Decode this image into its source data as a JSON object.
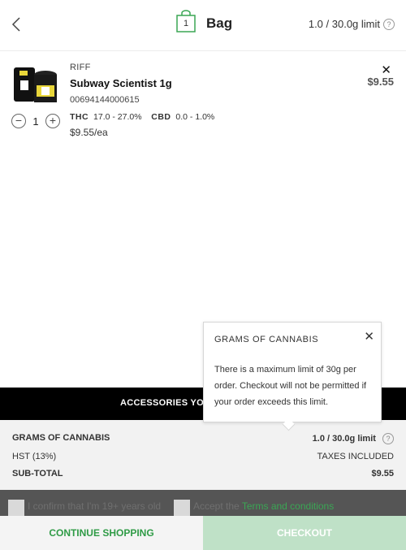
{
  "header": {
    "title": "Bag",
    "bag_count": "1",
    "limit_text": "1.0 / 30.0g limit"
  },
  "product": {
    "brand": "RIFF",
    "name": "Subway Scientist 1g",
    "sku": "00694144000615",
    "thc_label": "THC",
    "thc_value": "17.0 - 27.0%",
    "cbd_label": "CBD",
    "cbd_value": "0.0 - 1.0%",
    "unit_price": "$9.55/ea",
    "quantity": "1",
    "price": "$9.55",
    "remove_glyph": "✕"
  },
  "accessories": {
    "label": "ACCESSORIES YOU"
  },
  "summary": {
    "grams_label": "GRAMS OF CANNABIS",
    "grams_value": "1.0 / 30.0g limit",
    "hst_label": "HST (13%)",
    "hst_value": "TAXES INCLUDED",
    "subtotal_label": "SUB-TOTAL",
    "subtotal_value": "$9.55"
  },
  "confirm": {
    "age_text": "I confirm that I'm 19+ years old",
    "accept_text": "Accept the",
    "terms_link": "Terms and conditions"
  },
  "footer": {
    "continue_label": "CONTINUE SHOPPING",
    "checkout_label": "CHECKOUT"
  },
  "tooltip": {
    "title": "GRAMS OF CANNABIS",
    "body": "There is a maximum limit of 30g per order. Checkout will not be permitted if your order exceeds this limit.",
    "close_glyph": "✕"
  },
  "colors": {
    "accent_green": "#2f9b46",
    "checkout_disabled": "#bfe1c7"
  }
}
